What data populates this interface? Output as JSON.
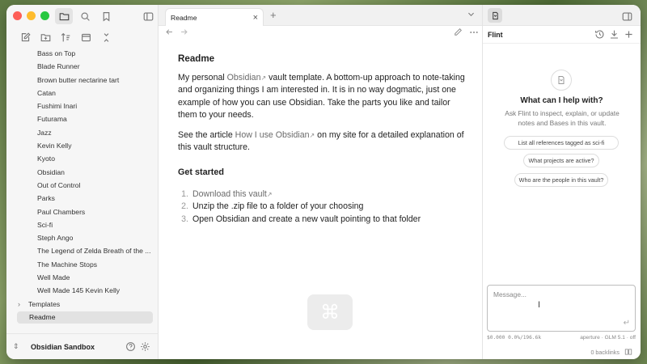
{
  "sidebar": {
    "files": [
      "Bass on Top",
      "Blade Runner",
      "Brown butter nectarine tart",
      "Catan",
      "Fushimi Inari",
      "Futurama",
      "Jazz",
      "Kevin Kelly",
      "Kyoto",
      "Obsidian",
      "Out of Control",
      "Parks",
      "Paul Chambers",
      "Sci-fi",
      "Steph Ango",
      "The Legend of Zelda Breath of the ...",
      "The Machine Stops",
      "Well Made",
      "Well Made 145 Kevin Kelly"
    ],
    "folder": "Templates",
    "active_file": "Readme",
    "vault_name": "Obsidian Sandbox"
  },
  "tab": {
    "title": "Readme"
  },
  "doc": {
    "title": "Readme",
    "p1_a": "My personal ",
    "p1_link": "Obsidian",
    "p1_b": " vault template. A bottom-up approach to note-taking and organizing things I am interested in. It is in no way dogmatic, just one example of how you can use Obsidian. Take the parts you like and tailor them to your needs.",
    "p2_a": "See the article ",
    "p2_link": "How I use Obsidian",
    "p2_b": " on my site for a detailed explanation of this vault structure.",
    "h2": "Get started",
    "steps": [
      {
        "num": "1.",
        "text": "Download this vault",
        "link": true
      },
      {
        "num": "2.",
        "text": "Unzip the .zip file to a folder of your choosing",
        "link": false
      },
      {
        "num": "3.",
        "text": "Open Obsidian and create a new vault pointing to that folder",
        "link": false
      }
    ],
    "cmd_glyph": "⌘"
  },
  "flint": {
    "name": "Flint",
    "help_title": "What can I help with?",
    "help_sub": "Ask Flint to inspect, explain, or update notes and Bases in this vault.",
    "chips": [
      "List all references tagged as sci-fi",
      "What projects are active?",
      "Who are the people in this vault?"
    ],
    "message_placeholder": "Message...",
    "cost": "$0.000 0.0%/196.6k",
    "model": "aperture · GLM 5.1 · off",
    "backlinks": "0 backlinks"
  }
}
